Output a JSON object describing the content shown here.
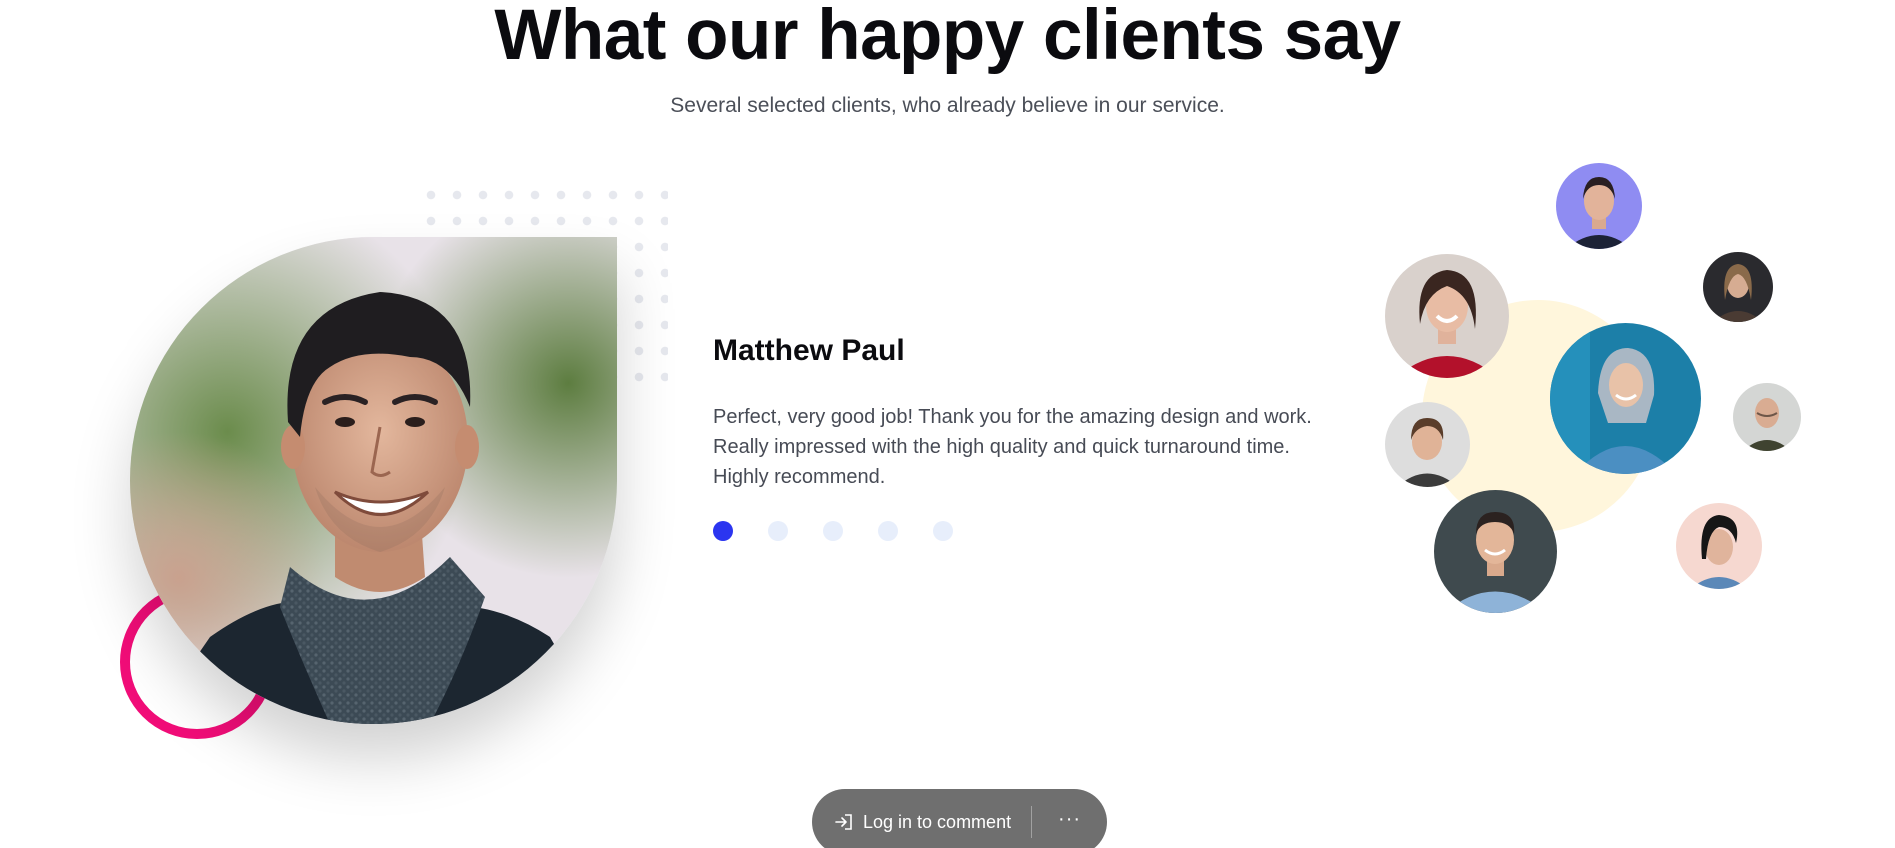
{
  "section": {
    "title": "What our happy clients say",
    "subtitle": "Several selected clients, who already believe in our service."
  },
  "testimonial": {
    "name": "Matthew Paul",
    "quote": "Perfect, very good job! Thank you for the amazing design and work. Really impressed with the high quality and quick turnaround time. Highly recommend.",
    "photo": "smiling-man-photo"
  },
  "pagination": {
    "total": 5,
    "active_index": 0
  },
  "avatars": [
    {
      "name": "avatar-woman-purple-bg"
    },
    {
      "name": "avatar-woman-red-top"
    },
    {
      "name": "avatar-woman-dark-hair"
    },
    {
      "name": "avatar-woman-blue-hood"
    },
    {
      "name": "avatar-man-bald"
    },
    {
      "name": "avatar-young-man"
    },
    {
      "name": "avatar-man-blue-shirt"
    },
    {
      "name": "avatar-woman-black-hair"
    }
  ],
  "comment_bar": {
    "login_label": "Log in to comment",
    "more_label": "···"
  },
  "colors": {
    "accent_blue": "#2b35f0",
    "pink_ring": "#f10d78",
    "yellow_circle": "#fff6dc",
    "inactive_dot": "#e7eefb"
  }
}
